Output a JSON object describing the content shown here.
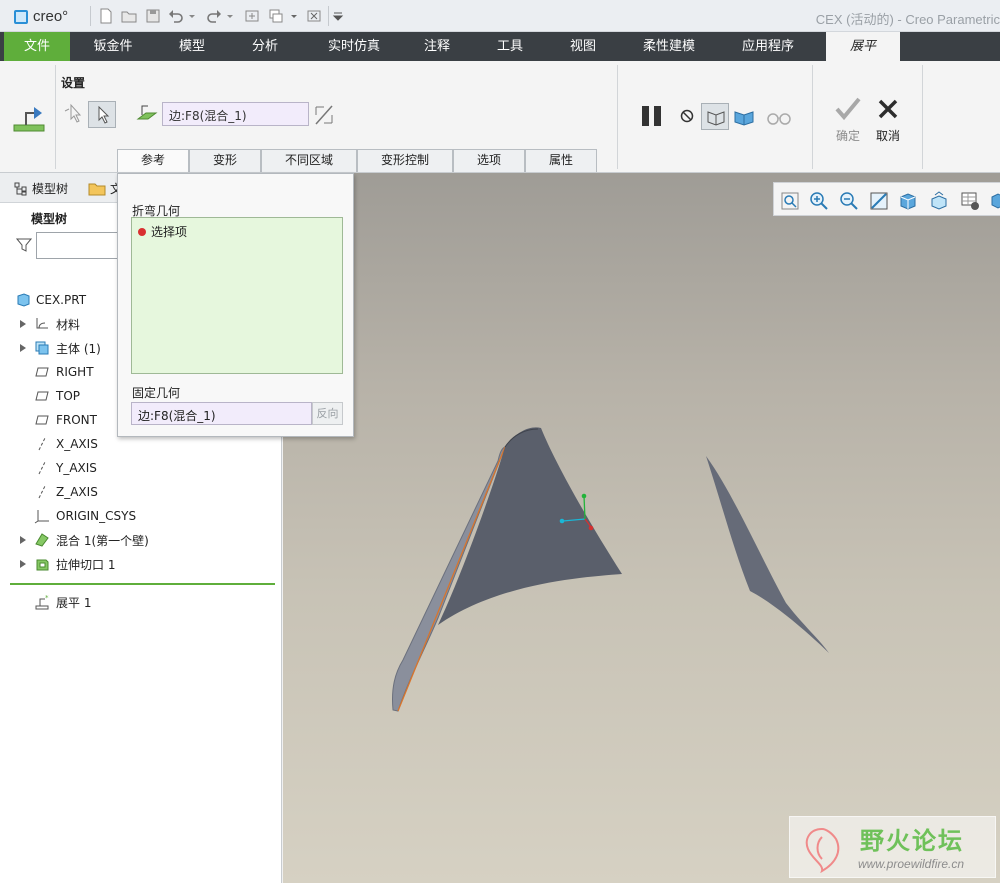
{
  "app": {
    "logo_text": "creo°",
    "window_title": "CEX (活动的) - Creo Parametric"
  },
  "ribbon_tabs": [
    {
      "label": "文件"
    },
    {
      "label": "钣金件"
    },
    {
      "label": "模型"
    },
    {
      "label": "分析"
    },
    {
      "label": "实时仿真"
    },
    {
      "label": "注释"
    },
    {
      "label": "工具"
    },
    {
      "label": "视图"
    },
    {
      "label": "柔性建模"
    },
    {
      "label": "应用程序"
    },
    {
      "label": "展平"
    }
  ],
  "ribbon": {
    "settings_title": "设置",
    "reference_value": "边:F8(混合_1)",
    "ok_label": "确定",
    "cancel_label": "取消",
    "sub_tabs": [
      {
        "label": "参考"
      },
      {
        "label": "变形"
      },
      {
        "label": "不同区域"
      },
      {
        "label": "变形控制"
      },
      {
        "label": "选项"
      },
      {
        "label": "属性"
      }
    ]
  },
  "left_panel": {
    "tabs": [
      {
        "label": "模型树"
      },
      {
        "label": "文"
      }
    ],
    "heading": "模型树",
    "filter_value": "",
    "tree": [
      {
        "label": "CEX.PRT",
        "icon": "part-icon"
      },
      {
        "label": "材料",
        "icon": "material-icon"
      },
      {
        "label": "主体 (1)",
        "icon": "body-icon"
      },
      {
        "label": "RIGHT",
        "icon": "datum-plane-icon"
      },
      {
        "label": "TOP",
        "icon": "datum-plane-icon"
      },
      {
        "label": "FRONT",
        "icon": "datum-plane-icon"
      },
      {
        "label": "X_AXIS",
        "icon": "datum-axis-icon"
      },
      {
        "label": "Y_AXIS",
        "icon": "datum-axis-icon"
      },
      {
        "label": "Z_AXIS",
        "icon": "datum-axis-icon"
      },
      {
        "label": "ORIGIN_CSYS",
        "icon": "csys-icon"
      },
      {
        "label": "混合 1(第一个壁)",
        "icon": "blend-icon"
      },
      {
        "label": "拉伸切口 1",
        "icon": "extrude-cut-icon"
      },
      {
        "label": "展平 1",
        "icon": "flatten-icon"
      }
    ]
  },
  "popup": {
    "bend_geometry_label": "折弯几何",
    "collector_item": "选择项",
    "fixed_geometry_label": "固定几何",
    "fixed_geometry_value": "边:F8(混合_1)",
    "reverse_label": "反向"
  },
  "watermark": {
    "title": "野火论坛",
    "url": "www.proewildfire.cn"
  },
  "colors": {
    "file_tab": "#5fae3b",
    "tab_bar": "#3a3f44",
    "collector_bg": "#e6f7dd",
    "surface": "#5a5f6b"
  }
}
